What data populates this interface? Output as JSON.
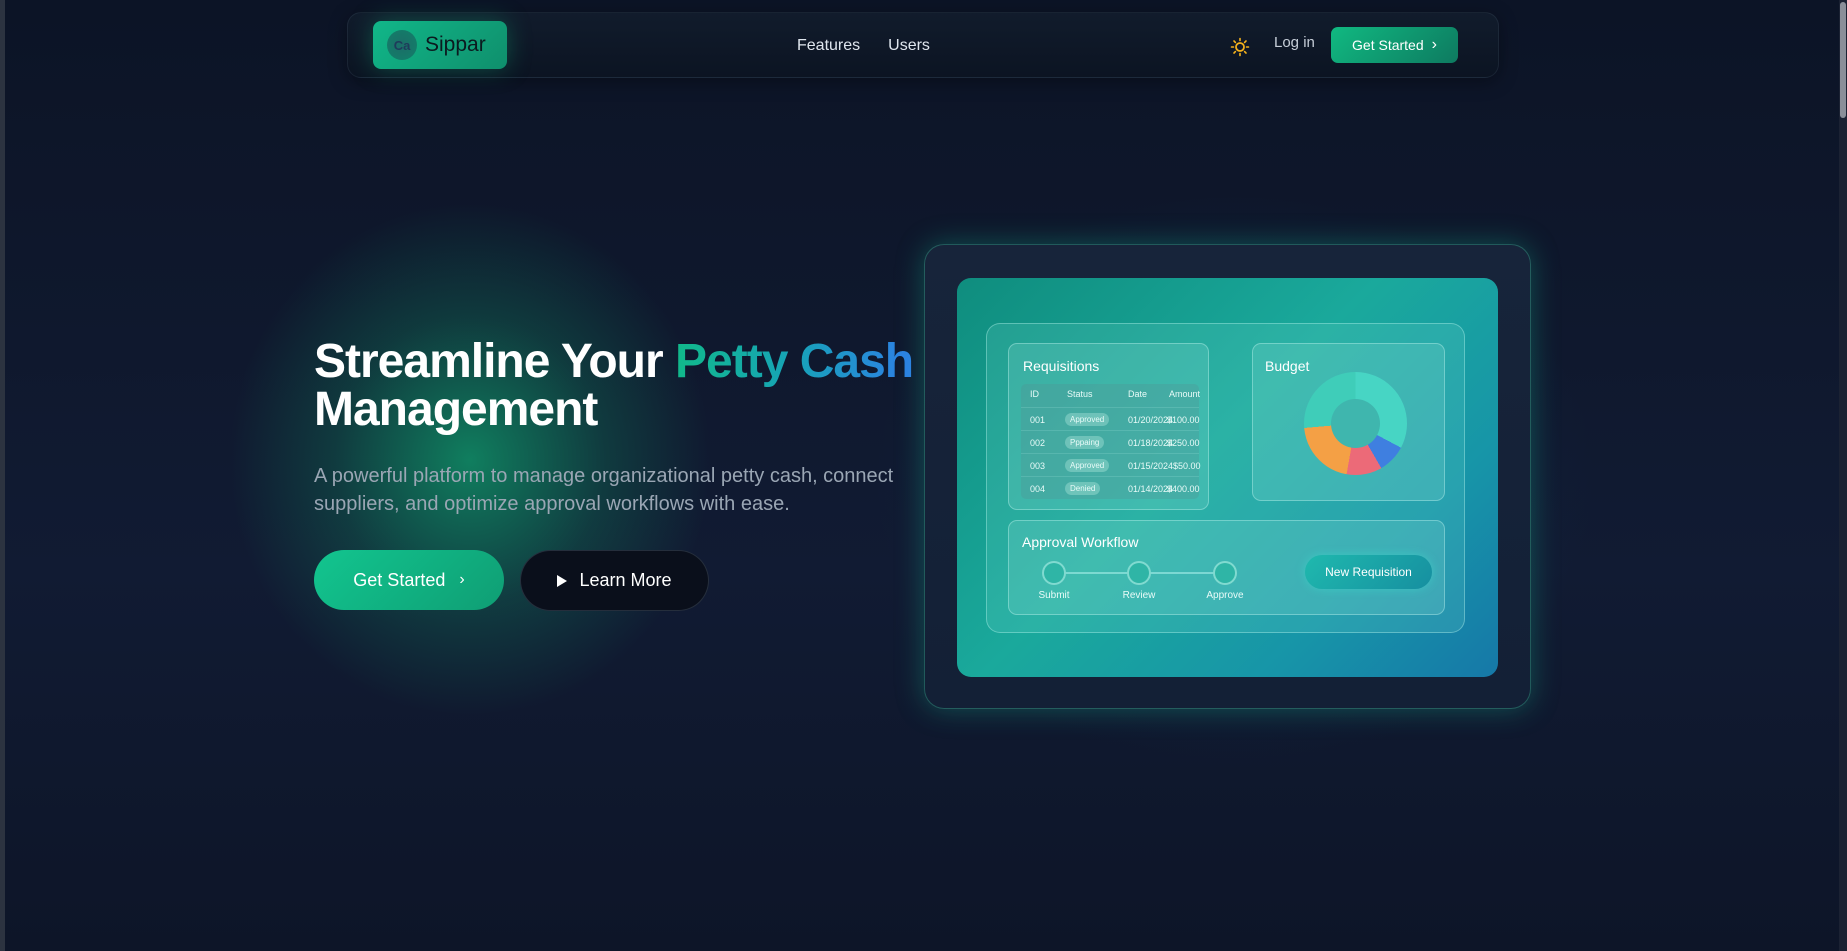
{
  "nav": {
    "brand_name": "Sippar",
    "brand_icon": "logo-icon",
    "links": [
      "Features",
      "Users"
    ],
    "theme_icon": "sun-icon",
    "login_label": "Log in",
    "cta_label": "Get Started"
  },
  "hero": {
    "title_part1": "Streamline Your ",
    "title_highlight": "Petty Cash",
    "title_part2": "Management",
    "subtitle": "A powerful platform to manage organizational petty cash, connect suppliers, and optimize approval workflows with ease.",
    "primary_button": "Get Started",
    "secondary_button": "Learn More"
  },
  "dashboard": {
    "requisitions": {
      "title": "Requisitions",
      "columns": [
        "ID",
        "Status",
        "Date",
        "Amount"
      ],
      "rows": [
        {
          "id": "001",
          "status": "Approved",
          "date": "01/20/2024",
          "amount": "$100.00"
        },
        {
          "id": "002",
          "status": "Pppaing",
          "date": "01/18/2024",
          "amount": "$250.00"
        },
        {
          "id": "003",
          "status": "Approved",
          "date": "01/15/2024",
          "amount": "$50.00"
        },
        {
          "id": "004",
          "status": "Denied",
          "date": "01/14/2024",
          "amount": "$400.00"
        }
      ]
    },
    "budget": {
      "title": "Budget"
    },
    "workflow": {
      "title": "Approval Workflow",
      "steps": [
        "Submit",
        "Review",
        "Approve"
      ],
      "button": "New Requisition"
    }
  },
  "colors": {
    "accent": "#10b981",
    "highlight_gradient_start": "#11b98a",
    "highlight_gradient_end": "#2e7fe6",
    "background": "#0b1224"
  }
}
